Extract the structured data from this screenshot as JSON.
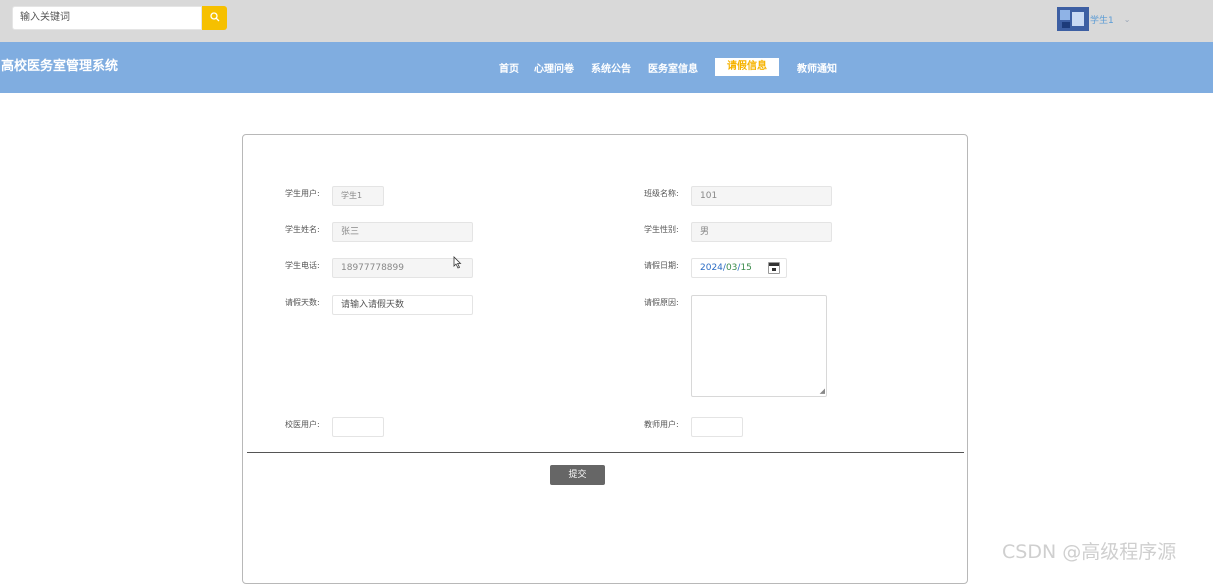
{
  "search": {
    "placeholder": "输入关键词",
    "icon": "search-icon"
  },
  "user": {
    "name": "学生1",
    "caret": "⌄"
  },
  "brand": {
    "title": "高校医务室管理系统"
  },
  "nav": {
    "items": [
      "首页",
      "心理问卷",
      "系统公告",
      "医务室信息",
      "请假信息",
      "教师通知"
    ],
    "active": "请假信息",
    "active_color": "#f6b300",
    "bar_color": "#80ade0"
  },
  "form": {
    "student_user": {
      "label": "学生用户:",
      "value": "学生1"
    },
    "class_name": {
      "label": "班级名称:",
      "value": "101"
    },
    "student_name": {
      "label": "学生姓名:",
      "value": "张三"
    },
    "student_gender": {
      "label": "学生性别:",
      "value": "男"
    },
    "student_phone": {
      "label": "学生电话:",
      "value": "18977778899"
    },
    "leave_date": {
      "label": "请假日期:",
      "year": "2024",
      "month": "03",
      "day": "15",
      "sep": "/"
    },
    "leave_days": {
      "label": "请假天数:",
      "placeholder": "请输入请假天数"
    },
    "leave_reason": {
      "label": "请假原因:",
      "value": ""
    },
    "doctor_user": {
      "label": "校医用户:",
      "value": ""
    },
    "teacher_user": {
      "label": "教师用户:",
      "value": ""
    },
    "submit_label": "提交"
  },
  "watermark": "CSDN @高级程序源"
}
